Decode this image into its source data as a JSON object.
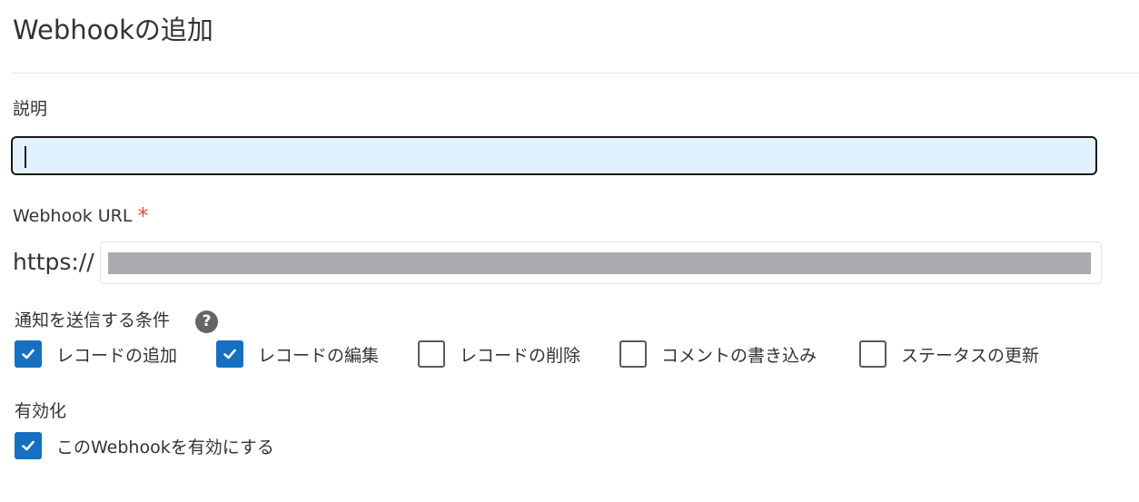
{
  "header": {
    "title": "Webhookの追加"
  },
  "description": {
    "label": "説明",
    "value": ""
  },
  "webhook_url": {
    "label": "Webhook URL",
    "required_mark": "*",
    "prefix": "https://",
    "value_redacted": true
  },
  "conditions": {
    "label": "通知を送信する条件",
    "help_icon": "help-circle-icon",
    "options": [
      {
        "label": "レコードの追加",
        "checked": true
      },
      {
        "label": "レコードの編集",
        "checked": true
      },
      {
        "label": "レコードの削除",
        "checked": false
      },
      {
        "label": "コメントの書き込み",
        "checked": false
      },
      {
        "label": "ステータスの更新",
        "checked": false
      }
    ]
  },
  "enable": {
    "label": "有効化",
    "checkbox_label": "このWebhookを有効にする",
    "checked": true
  },
  "colors": {
    "checkbox_checked": "#1570c1",
    "required_mark": "#e74c3c",
    "focused_input_bg": "#e2f1fe",
    "redaction": "#a9aaae"
  }
}
